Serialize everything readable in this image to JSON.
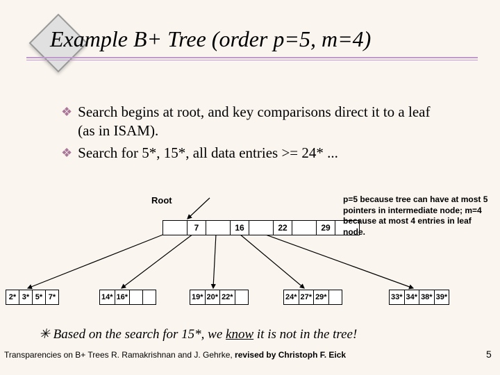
{
  "title": "Example B+ Tree (order p=5, m=4)",
  "bullets": {
    "b1": "Search begins at root, and key comparisons direct it to a leaf (as in ISAM).",
    "b2": "Search for 5*, 15*, all data entries >= 24* ..."
  },
  "root_label": "Root",
  "root_keys": {
    "k1": "7",
    "k2": "16",
    "k3": "22",
    "k4": "29"
  },
  "sidenote": "p=5 because tree can have at most 5 pointers in intermediate node; m=4 because at most 4 entries in leaf node.",
  "leaves": {
    "l1a": "2*",
    "l1b": "3*",
    "l1c": "5*",
    "l1d": "7*",
    "l2a": "14*",
    "l2b": "16*",
    "l3a": "19*",
    "l3b": "20*",
    "l3c": "22*",
    "l4a": "24*",
    "l4b": "27*",
    "l4c": "29*",
    "l5a": "33*",
    "l5b": "34*",
    "l5c": "38*",
    "l5d": "39*"
  },
  "footnote_prefix": "✳ Based on the search for 15*, we ",
  "footnote_know": "know",
  "footnote_suffix": " it is not in the tree!",
  "attribution_prefix": "Transparencies on B+ Trees R. Ramakrishnan and J. Gehrke, ",
  "attribution_bold": "revised by Christoph F. Eick",
  "pagenum": "5"
}
